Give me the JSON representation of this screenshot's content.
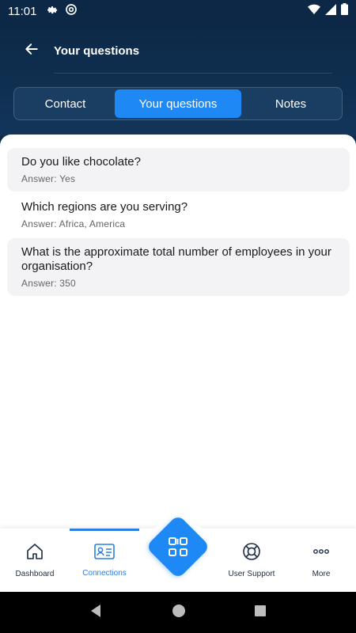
{
  "status_bar": {
    "time": "11:01",
    "icons": [
      "gear-icon",
      "at-sign-icon",
      "wifi-icon",
      "signal-icon",
      "battery-icon"
    ]
  },
  "header": {
    "title": "Your questions",
    "back_icon": "arrow-left-icon"
  },
  "tabs": [
    {
      "label": "Contact",
      "active": false
    },
    {
      "label": "Your questions",
      "active": true
    },
    {
      "label": "Notes",
      "active": false
    }
  ],
  "questions": [
    {
      "question": "Do you like chocolate?",
      "answer": "Answer: Yes"
    },
    {
      "question": "Which regions are you serving?",
      "answer": "Answer: Africa, America"
    },
    {
      "question": "What is the approximate total number of employees in your organisation?",
      "answer": "Answer: 350"
    }
  ],
  "bottom_nav": {
    "items": [
      {
        "label": "Dashboard",
        "icon": "home-icon",
        "active": false
      },
      {
        "label": "Connections",
        "icon": "contact-card-icon",
        "active": true
      },
      {
        "label": "User Support",
        "icon": "lifebuoy-icon",
        "active": false
      },
      {
        "label": "More",
        "icon": "more-dots-icon",
        "active": false
      }
    ],
    "center_button_icon": "qr-code-icon"
  },
  "colors": {
    "header_bg": "#0c2846",
    "accent": "#1e88f5",
    "active_nav": "#2a7de1"
  }
}
